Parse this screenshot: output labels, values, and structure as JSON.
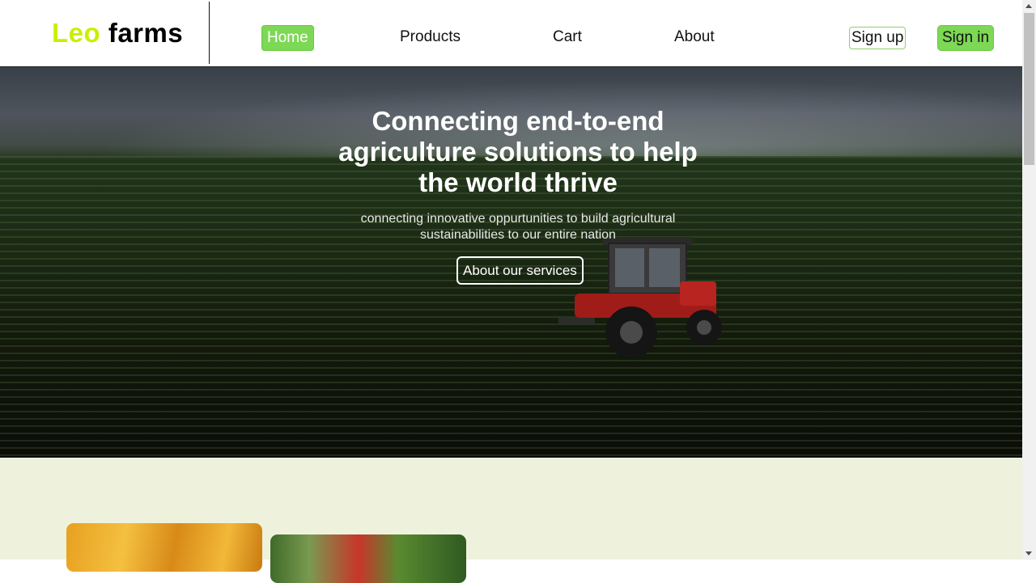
{
  "header": {
    "logo": {
      "word1": "Leo",
      "word2": "farms"
    },
    "nav": {
      "home": "Home",
      "products": "Products",
      "cart": "Cart",
      "about": "About"
    },
    "sign_up": "Sign up",
    "sign_in": "Sign in"
  },
  "hero": {
    "title": "Connecting end-to-end agriculture solutions to help the world thrive",
    "subtitle": "connecting innovative oppurtunities to build agricultural sustainabilities to our entire nation",
    "button": "About our services"
  },
  "colors": {
    "accent_green": "#7dd855",
    "logo_yellow": "#c8f000",
    "section_bg": "#eef2dc"
  }
}
